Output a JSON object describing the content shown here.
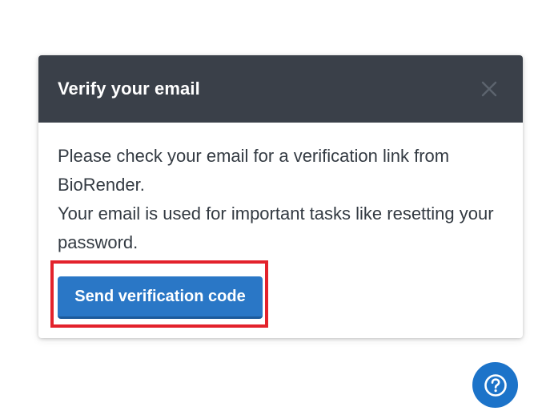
{
  "dialog": {
    "title": "Verify your email",
    "body_line1": "Please check your email for a verification link from BioRender.",
    "body_line2": "Your email is used for important tasks like resetting your password.",
    "primary_button_label": "Send verification code"
  },
  "icons": {
    "close": "close-icon",
    "help": "help-icon"
  },
  "colors": {
    "header_bg": "#3a4049",
    "primary_button": "#2a77c6",
    "highlight": "#e3222b",
    "help_button": "#1c73c9"
  }
}
